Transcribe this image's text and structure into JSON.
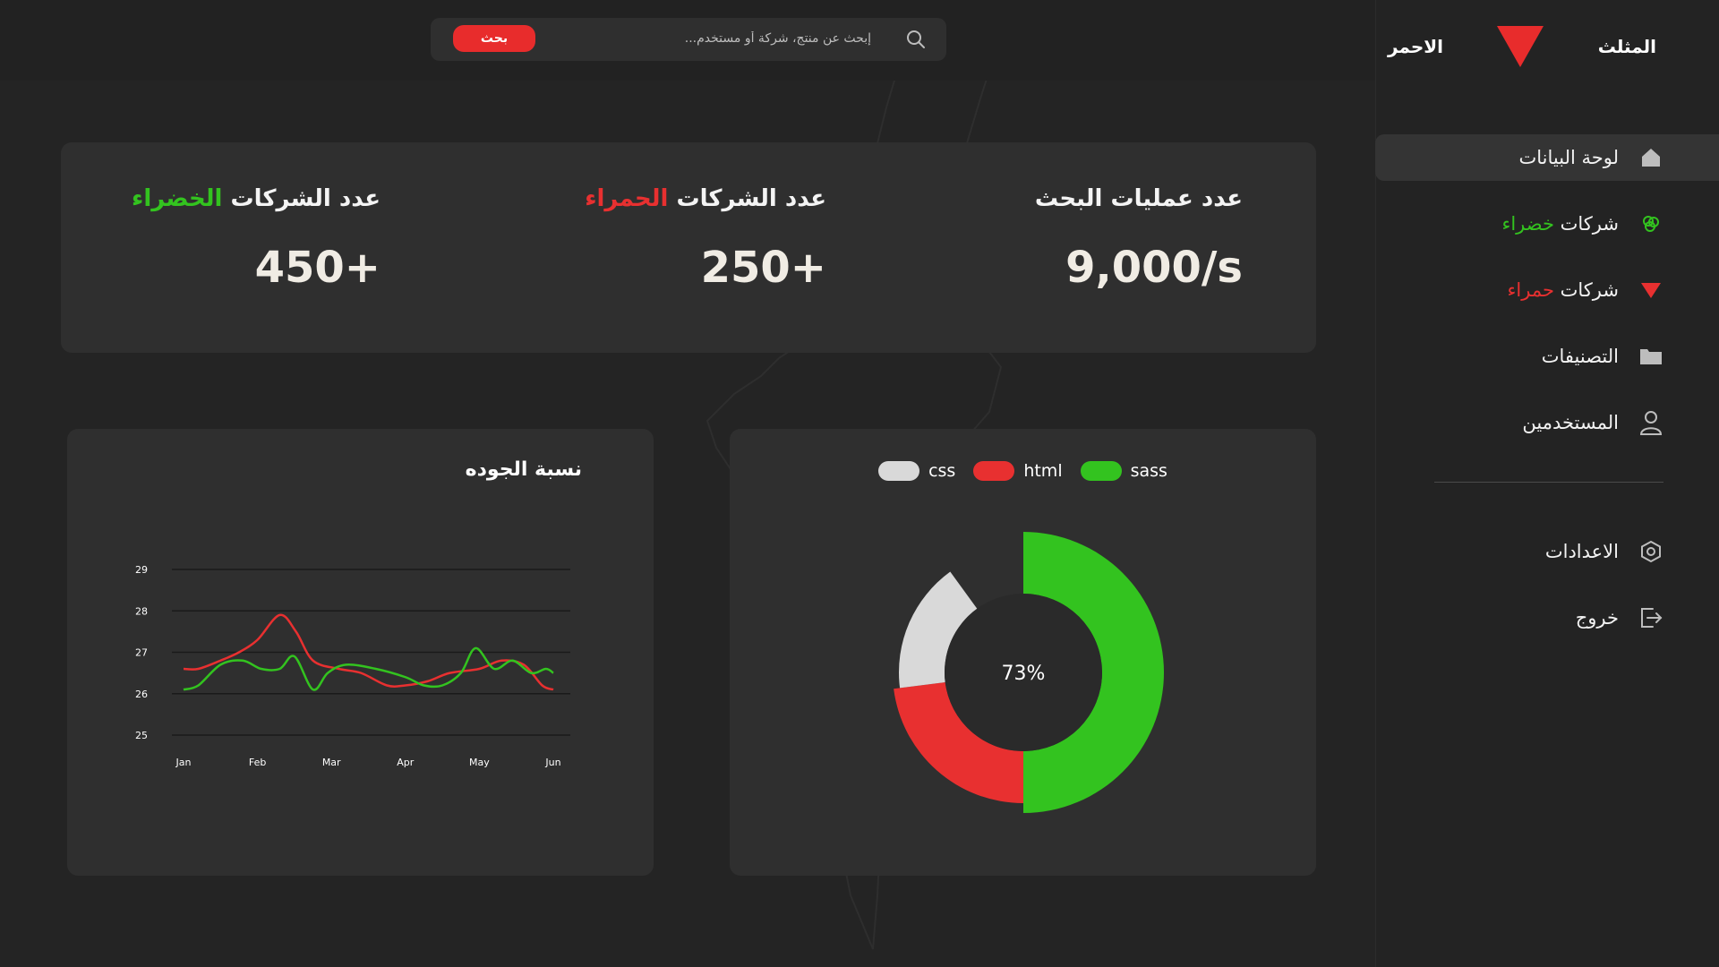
{
  "brand": {
    "word_right": "المثلث",
    "word_left": "الاحمر",
    "logo_color": "#e82c2c"
  },
  "search": {
    "placeholder": "إبحث عن منتج، شركة أو مستخدم...",
    "button_label": "بحث"
  },
  "sidebar": {
    "items": [
      {
        "label": "لوحة البيانات",
        "accent": "",
        "icon": "home-icon",
        "active": true
      },
      {
        "label": "شركات ",
        "accent": "خضراء",
        "accent_color": "green",
        "icon": "leaf-icon"
      },
      {
        "label": "شركات ",
        "accent": "حمراء",
        "accent_color": "red",
        "icon": "red-triangle-icon"
      },
      {
        "label": "التصنيفات",
        "accent": "",
        "icon": "folder-icon"
      },
      {
        "label": "المستخدمين",
        "accent": "",
        "icon": "user-icon"
      }
    ],
    "bottom_items": [
      {
        "label": "الاعدادات",
        "icon": "gear-icon"
      },
      {
        "label": "خروج",
        "icon": "logout-icon"
      }
    ]
  },
  "stats": [
    {
      "title": "عدد عمليات البحث",
      "accent": "",
      "value": "9,000/s"
    },
    {
      "title": "عدد الشركات ",
      "accent": "الحمراء",
      "accent_color": "red",
      "value": "250+"
    },
    {
      "title": "عدد الشركات ",
      "accent": "الخضراء",
      "accent_color": "green",
      "value": "450+"
    }
  ],
  "colors": {
    "green": "#33c31f",
    "red": "#e83030",
    "grey": "#d9d9d9",
    "card": "#2f2f2f",
    "bg": "#242424"
  },
  "chart_data": [
    {
      "type": "line",
      "title": "نسبة الجوده",
      "categories": [
        "Jan",
        "Feb",
        "Mar",
        "Apr",
        "May",
        "Jun"
      ],
      "yticks": [
        25,
        26,
        27,
        28,
        29
      ],
      "ylim": [
        25,
        29
      ],
      "grid": true,
      "series": [
        {
          "color": "#e83030",
          "x": [
            0,
            0.2,
            0.5,
            0.75,
            1.0,
            1.3,
            1.52,
            1.75,
            2.1,
            2.4,
            2.75,
            3.0,
            3.3,
            3.6,
            4.0,
            4.3,
            4.6,
            4.85,
            5.0
          ],
          "values": [
            26.6,
            26.6,
            26.8,
            27.0,
            27.3,
            27.9,
            27.5,
            26.8,
            26.6,
            26.5,
            26.2,
            26.2,
            26.3,
            26.5,
            26.6,
            26.8,
            26.7,
            26.2,
            26.1
          ]
        },
        {
          "color": "#33c31f",
          "x": [
            0,
            0.2,
            0.5,
            0.8,
            1.05,
            1.3,
            1.5,
            1.75,
            1.95,
            2.2,
            2.6,
            3.0,
            3.25,
            3.5,
            3.75,
            3.95,
            4.2,
            4.45,
            4.7,
            4.9,
            5.0
          ],
          "values": [
            26.1,
            26.2,
            26.7,
            26.8,
            26.6,
            26.6,
            26.9,
            26.1,
            26.5,
            26.7,
            26.6,
            26.4,
            26.2,
            26.2,
            26.5,
            27.1,
            26.6,
            26.8,
            26.5,
            26.6,
            26.5
          ]
        }
      ]
    },
    {
      "type": "pie",
      "style": "donut",
      "center_label": "73%",
      "legend": [
        "css",
        "html",
        "sass"
      ],
      "slices": [
        {
          "label": "sass",
          "value": 50,
          "color": "#33c31f"
        },
        {
          "label": "html",
          "value": 23,
          "color": "#e83030"
        },
        {
          "label": "css",
          "value": 17,
          "color": "#d9d9d9"
        }
      ]
    }
  ]
}
